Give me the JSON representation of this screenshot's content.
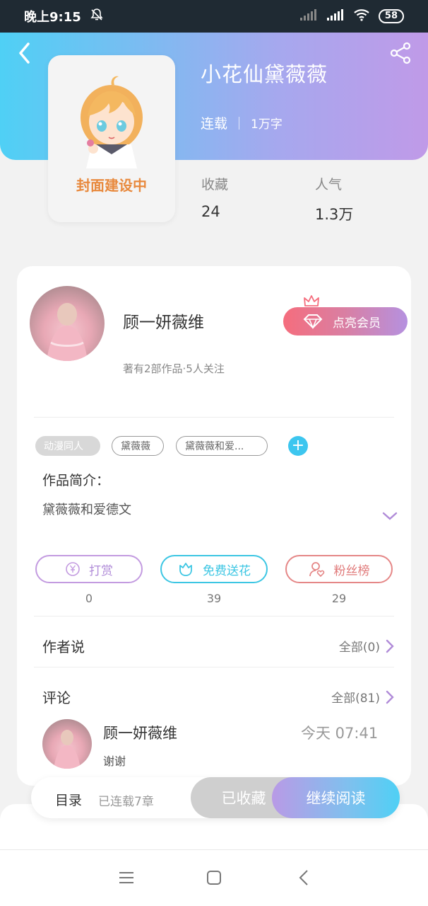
{
  "status_bar": {
    "time": "晚上9:15",
    "battery": "58"
  },
  "book": {
    "title": "小花仙黛薇薇",
    "status": "连载",
    "word_count": "1万字",
    "cover_caption": "封面建设中",
    "stats": [
      {
        "label": "收藏",
        "value": "24"
      },
      {
        "label": "人气",
        "value": "1.3万"
      }
    ]
  },
  "author": {
    "name": "顾一妍薇维",
    "info": "著有2部作品·5人关注",
    "vip_button": "点亮会员"
  },
  "tags": [
    "动漫同人",
    "黛薇薇",
    "黛薇薇和爱..."
  ],
  "intro": {
    "label": "作品简介：",
    "text": "黛薇薇和爱德文"
  },
  "actions": [
    {
      "label": "打赏",
      "count": "0",
      "color": "#c39be0"
    },
    {
      "label": "免费送花",
      "count": "39",
      "color": "#3cc6e3"
    },
    {
      "label": "粉丝榜",
      "count": "29",
      "color": "#e58787"
    }
  ],
  "author_says": {
    "title": "作者说",
    "link": "全部(0)"
  },
  "comments": {
    "title": "评论",
    "link": "全部(81)",
    "items": [
      {
        "name": "顾一妍薇维",
        "time": "今天 07:41",
        "text": "谢谢"
      }
    ]
  },
  "bottom_bar": {
    "toc": "目录",
    "toc_status": "已连载7章",
    "favorited": "已收藏",
    "continue": "继续阅读"
  },
  "colors": {
    "accent_cyan": "#4fd0f5",
    "accent_purple": "#c09ae8",
    "vip_red": "#f56d7d"
  }
}
